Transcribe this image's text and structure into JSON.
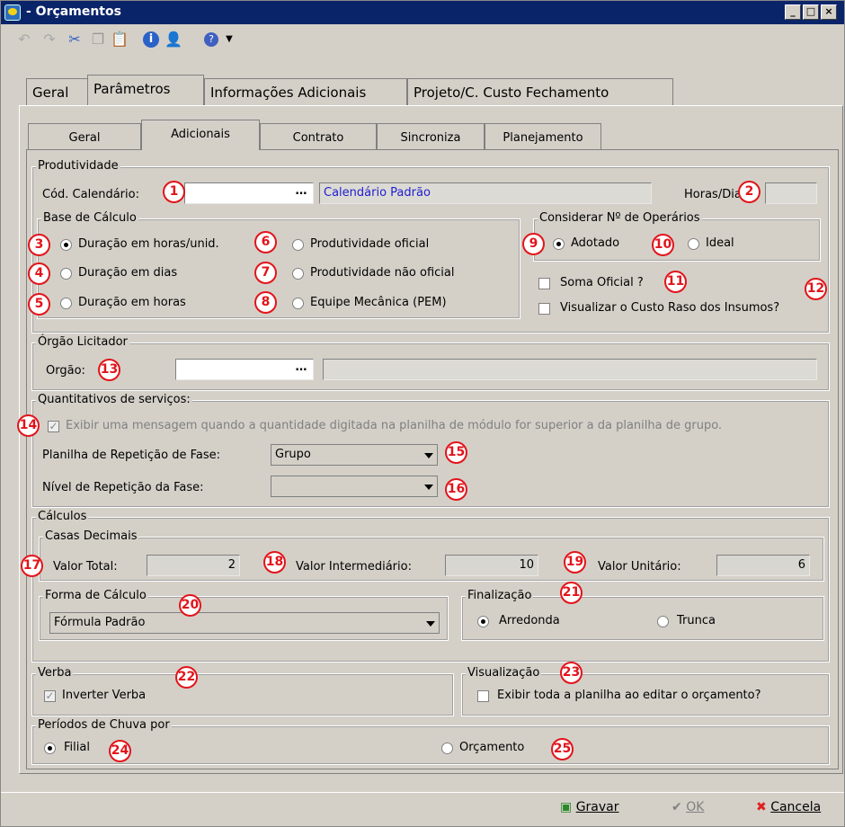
{
  "window": {
    "title": "- Orçamentos"
  },
  "toolbar": {
    "icons": [
      "undo-icon",
      "redo-icon",
      "cut-icon",
      "copy-icon",
      "paste-icon",
      "info-icon",
      "user-icon",
      "help-icon"
    ]
  },
  "tabs_main": [
    "Geral",
    "Parâmetros",
    "Informações Adicionais",
    "Projeto/C. Custo Fechamento"
  ],
  "tabs_sub": [
    "Geral",
    "Adicionais",
    "Contrato",
    "Sincroniza",
    "Planejamento"
  ],
  "produtividade": {
    "title": "Produtividade",
    "cod_label": "Cód. Calendário:",
    "cod_value": "",
    "calendar_name": "Calendário Padrão",
    "horas_label": "Horas/Dia:",
    "horas_value": ""
  },
  "base": {
    "title": "Base de Cálculo",
    "opt1": "Duração em horas/unid.",
    "opt2": "Duração em dias",
    "opt3": "Duração em horas",
    "opt4": "Produtividade oficial",
    "opt5": "Produtividade não oficial",
    "opt6": "Equipe Mecânica (PEM)"
  },
  "operarios": {
    "title": "Considerar Nº de Operários",
    "adotado": "Adotado",
    "ideal": "Ideal"
  },
  "soma": "Soma Oficial ?",
  "custo": "Visualizar o Custo Raso dos Insumos?",
  "orgao": {
    "title": "Órgão Licitador",
    "label": "Orgão:",
    "value": "",
    "name": ""
  },
  "quant": {
    "title": "Quantitativos de serviços:",
    "msg": "Exibir uma mensagem quando a quantidade digitada na planilha de módulo for superior a da planilha de grupo.",
    "rep_label": "Planilha de Repetição de Fase:",
    "rep_value": "Grupo",
    "nivel_label": "Nível de Repetição da Fase:",
    "nivel_value": ""
  },
  "calc": {
    "title": "Cálculos",
    "casas": "Casas Decimais",
    "vt_label": "Valor Total:",
    "vt": "2",
    "vi_label": "Valor Intermediário:",
    "vi": "10",
    "vu_label": "Valor Unitário:",
    "vu": "6",
    "forma_title": "Forma de Cálculo",
    "forma_value": "Fórmula Padrão",
    "final_title": "Finalização",
    "arred": "Arredonda",
    "trunca": "Trunca"
  },
  "verba": {
    "title": "Verba",
    "inverter": "Inverter Verba"
  },
  "visual": {
    "title": "Visualização",
    "exibir": "Exibir toda a planilha ao editar o orçamento?"
  },
  "chuva": {
    "title": "Períodos de Chuva por",
    "filial": "Filial",
    "orcamento": "Orçamento"
  },
  "buttons": {
    "gravar": "Gravar",
    "ok": "OK",
    "cancela": "Cancela"
  },
  "markers": [
    "1",
    "2",
    "3",
    "4",
    "5",
    "6",
    "7",
    "8",
    "9",
    "10",
    "11",
    "12",
    "13",
    "14",
    "15",
    "16",
    "17",
    "18",
    "19",
    "20",
    "21",
    "22",
    "23",
    "24",
    "25"
  ]
}
